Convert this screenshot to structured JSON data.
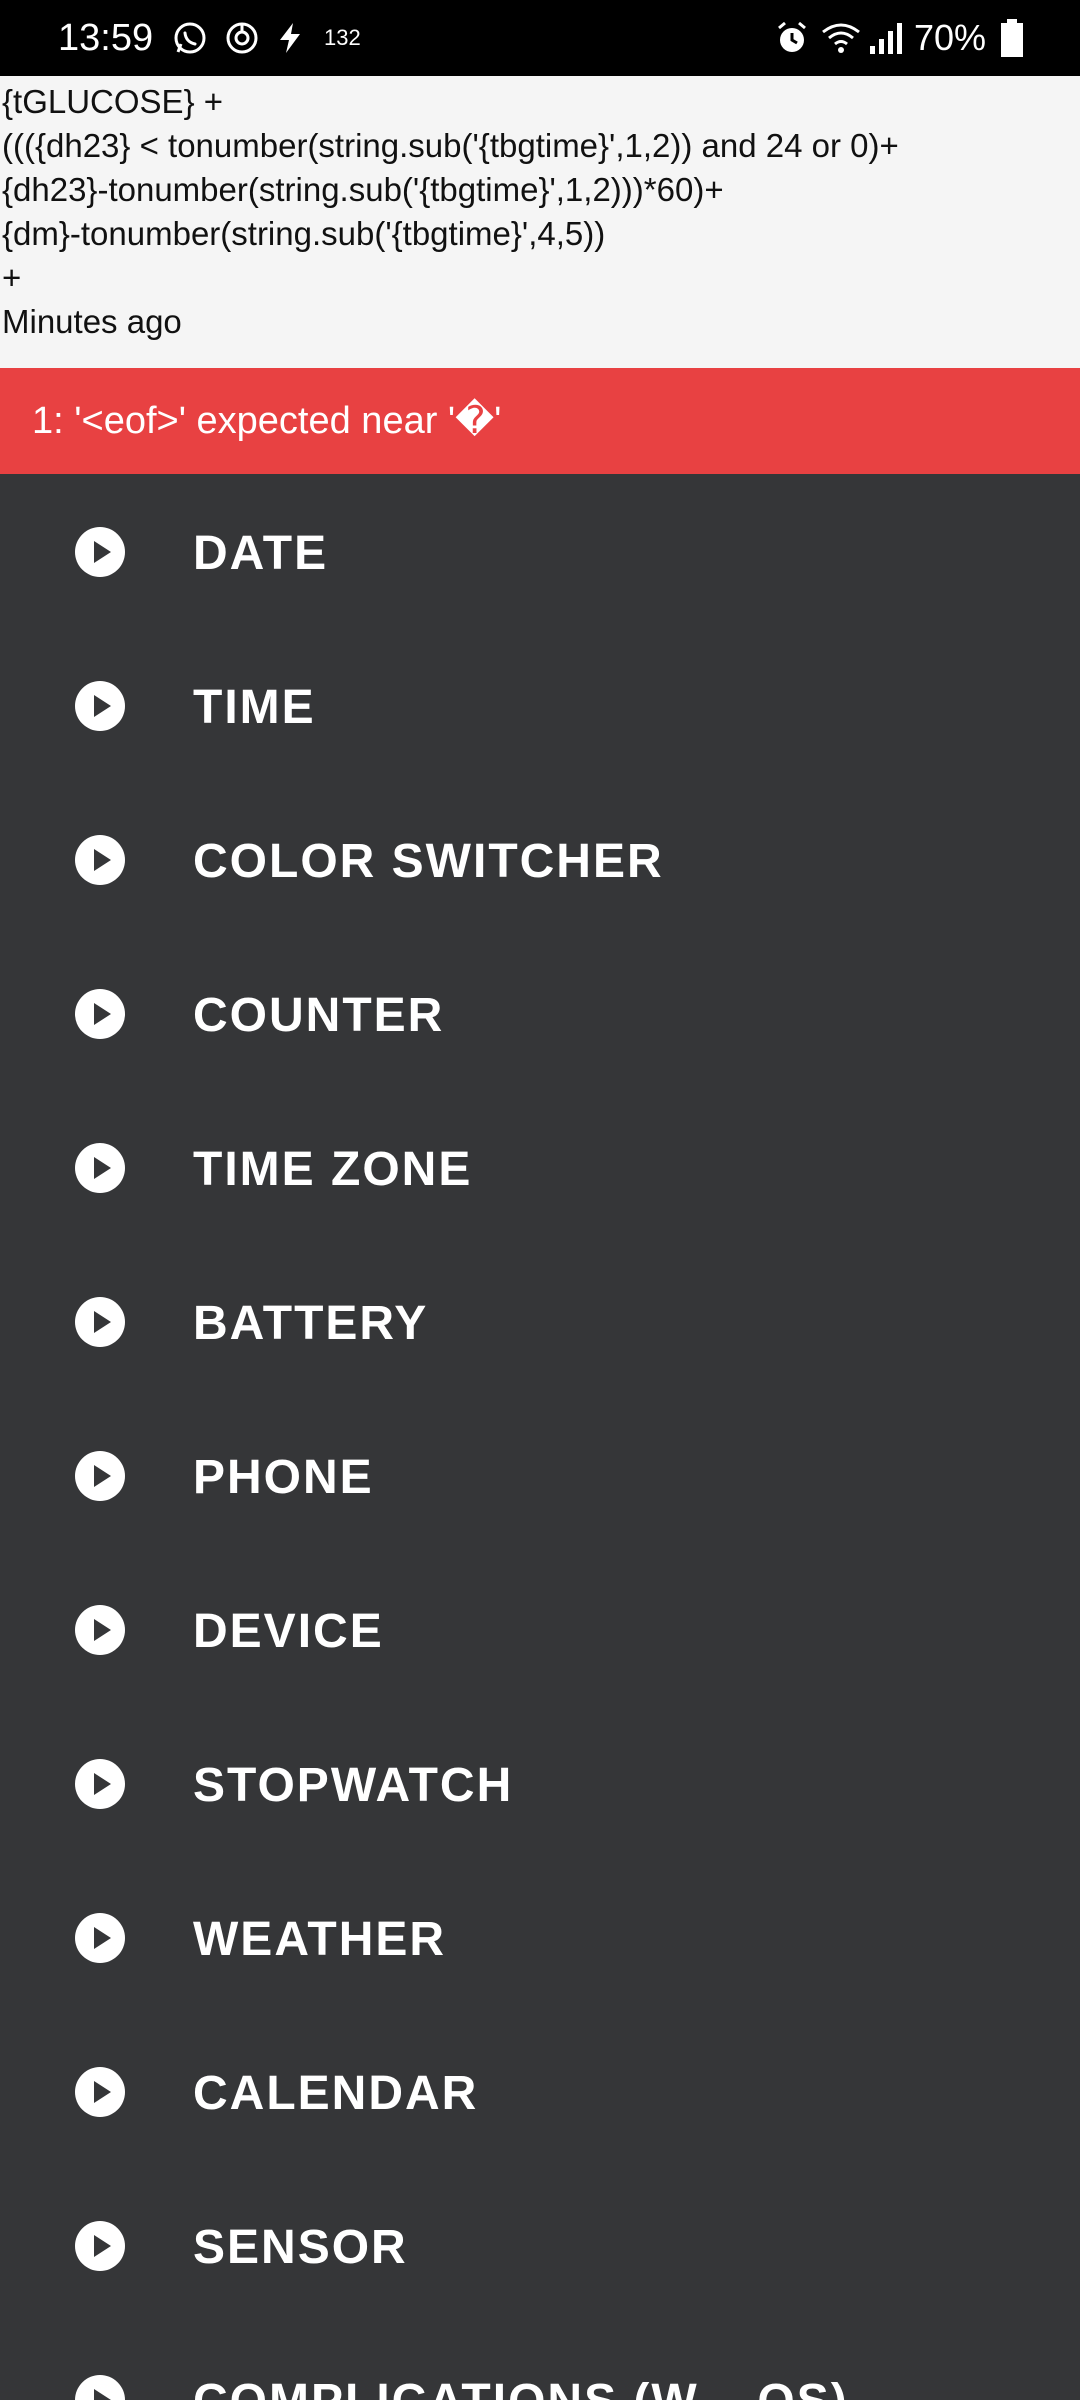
{
  "status_bar": {
    "time": "13:59",
    "notification_count": "132",
    "battery_percent": "70%",
    "icons": [
      "whatsapp-icon",
      "vpn-icon",
      "charging-bolt-icon",
      "alarm-icon",
      "wifi-icon",
      "signal-icon",
      "battery-icon"
    ]
  },
  "editor": {
    "lines": [
      "{tGLUCOSE} +",
      "((({dh23} < tonumber(string.sub('{tbgtime}',1,2)) and 24 or 0)+",
      "{dh23}-tonumber(string.sub('{tbgtime}',1,2)))*60)+",
      "{dm}-tonumber(string.sub('{tbgtime}',4,5))",
      "+",
      "Minutes ago"
    ]
  },
  "error": {
    "message": "1: '<eof>' expected near '�'",
    "color": "#e84142"
  },
  "menu": {
    "items": [
      {
        "label": "DATE"
      },
      {
        "label": "TIME"
      },
      {
        "label": "COLOR SWITCHER"
      },
      {
        "label": "COUNTER"
      },
      {
        "label": "TIME ZONE"
      },
      {
        "label": "BATTERY"
      },
      {
        "label": "PHONE"
      },
      {
        "label": "DEVICE"
      },
      {
        "label": "STOPWATCH"
      },
      {
        "label": "WEATHER"
      },
      {
        "label": "CALENDAR"
      },
      {
        "label": "SENSOR"
      },
      {
        "label": "COMPLICATIONS (W... OS)"
      }
    ],
    "background": "#353638",
    "icon": "play-circle-icon"
  }
}
